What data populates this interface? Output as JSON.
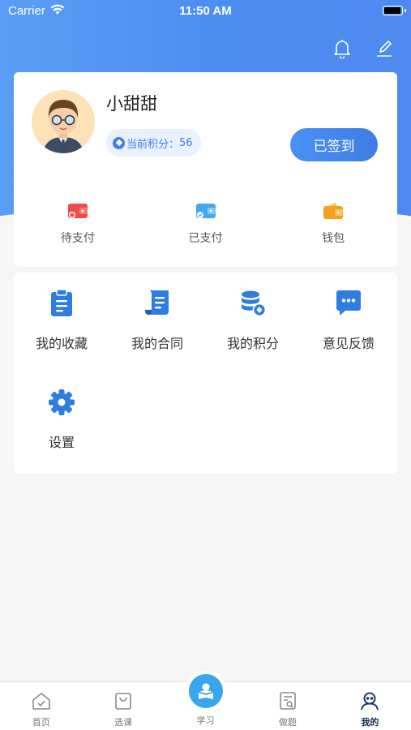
{
  "status_bar": {
    "carrier": "Carrier",
    "time": "11:50 AM",
    "battery_level": 0.95
  },
  "header": {
    "icons": [
      "bell-icon",
      "edit-icon"
    ]
  },
  "profile": {
    "name": "小甜甜",
    "points_label": "当前积分",
    "points_sep": "：",
    "points_value": "56",
    "checkin_label": "已签到"
  },
  "payments": [
    {
      "label": "待支付",
      "icon": "wallet-pending-icon",
      "color": "#ee4c4c"
    },
    {
      "label": "已支付",
      "icon": "wallet-paid-icon",
      "color": "#45a8ee"
    },
    {
      "label": "钱包",
      "icon": "wallet-icon",
      "color": "#f5a020"
    }
  ],
  "menu": [
    {
      "label": "我的收藏",
      "icon": "clipboard-icon"
    },
    {
      "label": "我的合同",
      "icon": "contract-icon"
    },
    {
      "label": "我的积分",
      "icon": "points-database-icon"
    },
    {
      "label": "意见反馈",
      "icon": "feedback-chat-icon"
    },
    {
      "label": "设置",
      "icon": "gear-icon"
    }
  ],
  "tabs": [
    {
      "label": "首页",
      "icon": "home-icon"
    },
    {
      "label": "选课",
      "icon": "shopping-bag-icon"
    },
    {
      "label": "学习",
      "icon": "study-icon"
    },
    {
      "label": "做题",
      "icon": "exercise-icon"
    },
    {
      "label": "我的",
      "icon": "profile-icon",
      "active": true
    }
  ],
  "colors": {
    "accent": "#3f7ee8",
    "header_start": "#5a9df6",
    "icon_blue": "#2f7de1"
  }
}
